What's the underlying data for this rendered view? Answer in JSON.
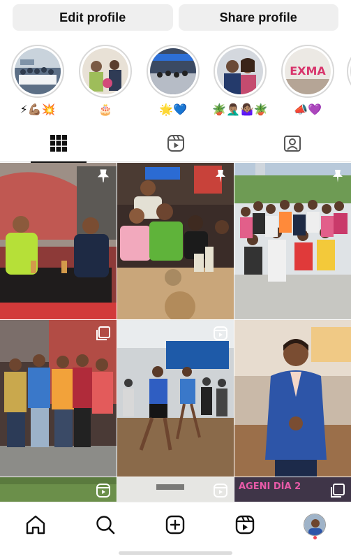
{
  "profile_actions": {
    "edit_label": "Edit profile",
    "share_label": "Share profile"
  },
  "highlights": [
    {
      "label": "⚡💪🏽💥",
      "image": "group-photo"
    },
    {
      "label": "🎂",
      "image": "family-photo"
    },
    {
      "label": "🌟💙",
      "image": "event-photo"
    },
    {
      "label": "🪴🤦🏽‍♂️🤷🏽‍♀️🪴",
      "image": "selfie-photo"
    },
    {
      "label": "📣💜",
      "image": "sign-photo"
    }
  ],
  "tabs": [
    {
      "name": "posts-grid",
      "icon": "grid-icon",
      "active": true
    },
    {
      "name": "reels",
      "icon": "reels-icon",
      "active": false
    },
    {
      "name": "tagged",
      "icon": "tagged-person-icon",
      "active": false
    }
  ],
  "grid": {
    "posts": [
      {
        "id": "post-1",
        "badge": "pin-icon",
        "scene": "two men at a restaurant table"
      },
      {
        "id": "post-2",
        "badge": "pin-icon",
        "scene": "friends at a bar table"
      },
      {
        "id": "post-3",
        "badge": "pin-icon",
        "scene": "large group photo outdoors"
      },
      {
        "id": "post-4",
        "badge": "carousel-icon",
        "scene": "group of six friends posing"
      },
      {
        "id": "post-5",
        "badge": "reel-icon",
        "scene": "dance class"
      },
      {
        "id": "post-6",
        "badge": "none",
        "scene": "man in blue suit"
      },
      {
        "id": "post-7",
        "badge": "reel-icon",
        "scene": "outdoor gathering"
      },
      {
        "id": "post-8",
        "badge": "reel-icon",
        "scene": "indoor event"
      },
      {
        "id": "post-9",
        "badge": "carousel-icon",
        "scene": "event stage banner",
        "text": "AGENI DÍA 2"
      }
    ]
  },
  "bottom_nav": [
    {
      "name": "home",
      "icon": "home-icon"
    },
    {
      "name": "search",
      "icon": "search-icon"
    },
    {
      "name": "create",
      "icon": "create-post-icon"
    },
    {
      "name": "reels",
      "icon": "reels-icon"
    },
    {
      "name": "profile",
      "icon": "profile-avatar-icon"
    }
  ],
  "colors": {
    "button_bg": "#efefef",
    "notification_dot": "#ed4956",
    "text": "#111111"
  }
}
